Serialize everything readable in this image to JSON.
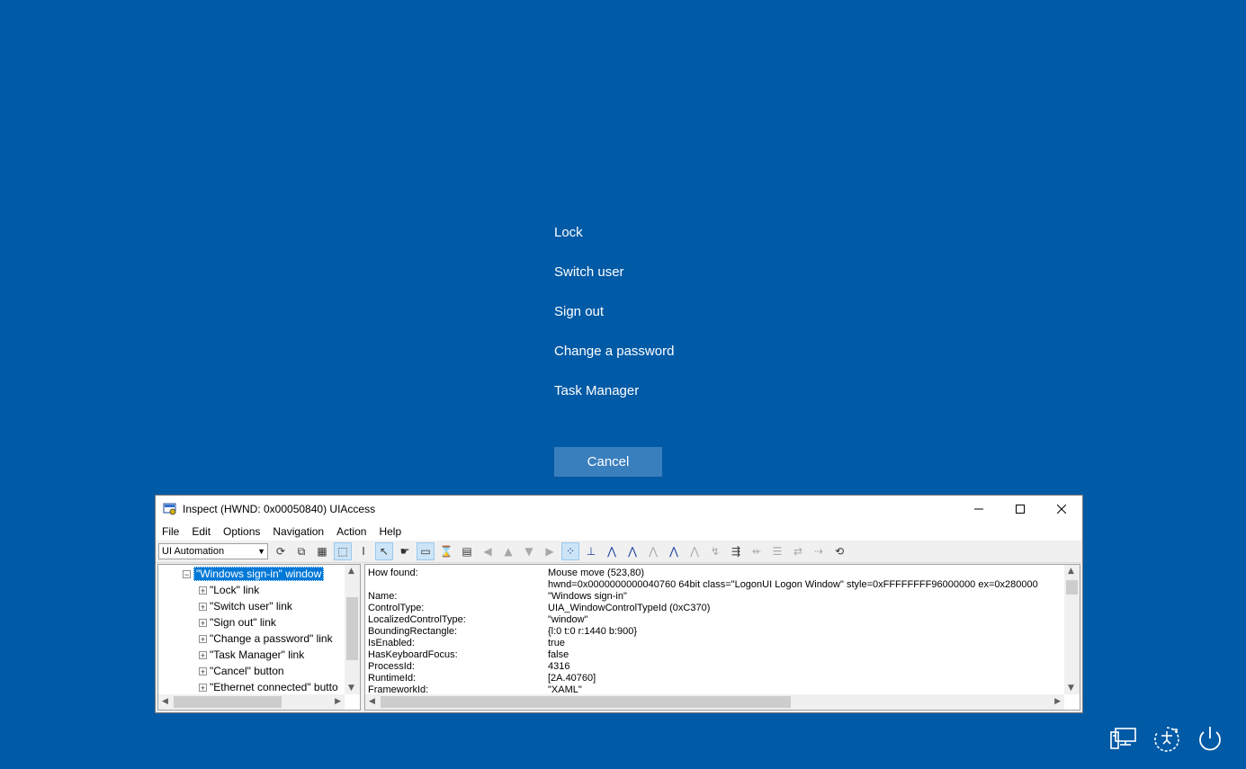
{
  "options": [
    "Lock",
    "Switch user",
    "Sign out",
    "Change a password",
    "Task Manager"
  ],
  "cancel_label": "Cancel",
  "system_icons": [
    "network-icon",
    "accessibility-icon",
    "power-icon"
  ],
  "inspect": {
    "title": "Inspect  (HWND: 0x00050840) UIAccess",
    "menu": [
      "File",
      "Edit",
      "Options",
      "Navigation",
      "Action",
      "Help"
    ],
    "mode": "UI Automation",
    "tree": {
      "root": "\"Windows sign-in\" window",
      "children": [
        "\"Lock\" link",
        "\"Switch user\" link",
        "\"Sign out\" link",
        "\"Change a password\" link",
        "\"Task Manager\" link",
        "\"Cancel\" button",
        "\"Ethernet connected\" butto"
      ]
    },
    "properties": [
      {
        "key": "How found:",
        "value": "Mouse move (523,80)"
      },
      {
        "key": "",
        "value": "hwnd=0x0000000000040760 64bit class=\"LogonUI Logon Window\" style=0xFFFFFFFF96000000 ex=0x280000"
      },
      {
        "key": "Name:",
        "value": "\"Windows sign-in\""
      },
      {
        "key": "ControlType:",
        "value": "UIA_WindowControlTypeId (0xC370)"
      },
      {
        "key": "LocalizedControlType:",
        "value": "\"window\""
      },
      {
        "key": "BoundingRectangle:",
        "value": "{l:0 t:0 r:1440 b:900}"
      },
      {
        "key": "IsEnabled:",
        "value": "true"
      },
      {
        "key": "HasKeyboardFocus:",
        "value": "false"
      },
      {
        "key": "ProcessId:",
        "value": "4316"
      },
      {
        "key": "RuntimeId:",
        "value": "[2A.40760]"
      },
      {
        "key": "FrameworkId:",
        "value": "\"XAML\""
      }
    ]
  }
}
